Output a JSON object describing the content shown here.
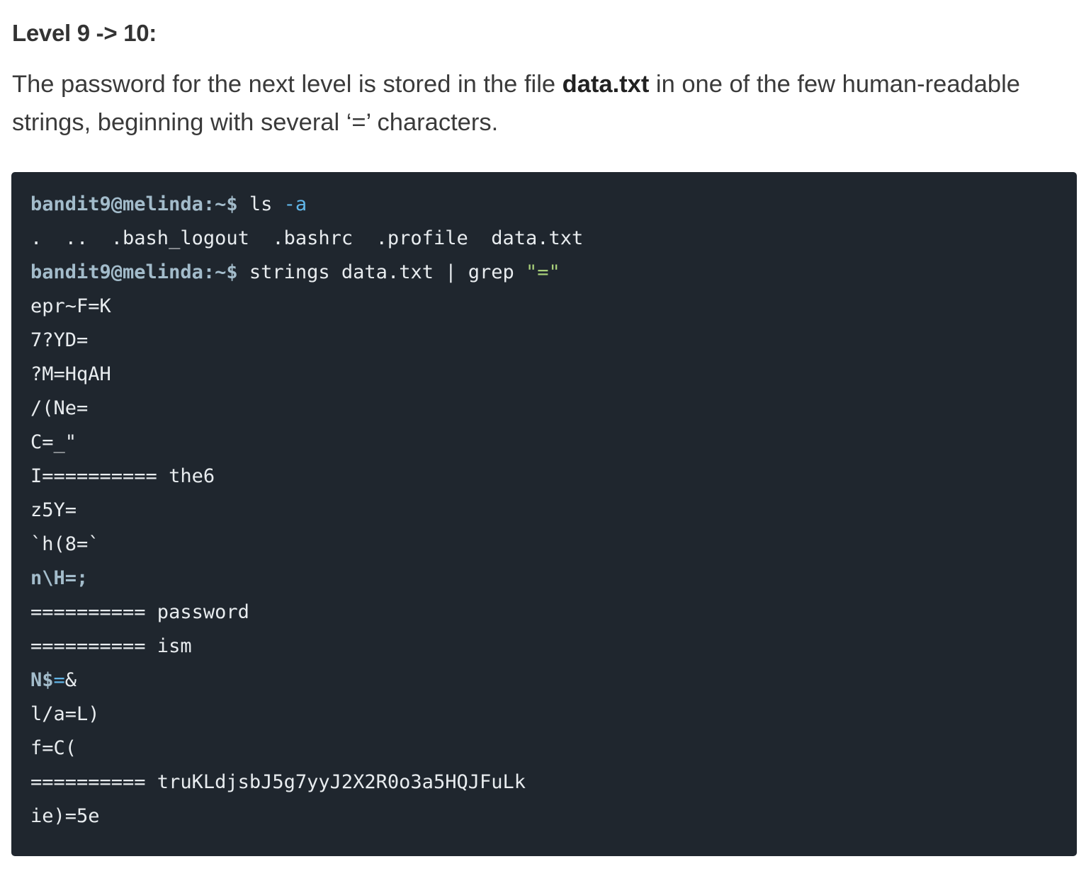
{
  "heading": "Level 9 -> 10:",
  "description": {
    "before": "The password for the next level is stored in the file ",
    "filename": "data.txt",
    "after": " in one of the few human-readable strings, beginning with several ‘=’ characters."
  },
  "terminal": {
    "prompt": "bandit9@melinda:~$",
    "command1": {
      "name": "ls",
      "flag": "-a"
    },
    "ls_output": ".  ..  .bash_logout  .bashrc  .profile  data.txt",
    "command2": {
      "text": "strings data.txt | grep",
      "arg": "\"=\""
    },
    "output_lines": {
      "l1": "epr~F=K",
      "l2": "7?YD=",
      "l3": "?M=HqAH",
      "l4": "/(Ne=",
      "l5": "C=_\"",
      "l6": "I========== the6",
      "l7": "z5Y=",
      "l8": "`h(8=`",
      "l9": "n\\H=;",
      "l10": "========== password",
      "l11": "========== ism",
      "l12a": "N$",
      "l12b": "=",
      "l12c": "&",
      "l13": "l/a=L)",
      "l14": "f=C(",
      "l15": "========== truKLdjsbJ5g7yyJ2X2R0o3a5HQJFuLk",
      "l16": "ie)=5e"
    }
  },
  "colors": {
    "terminal_background": "#1f262e",
    "prompt": "#a3bccb",
    "flag": "#61b6e8",
    "string": "#a9d07a",
    "text": "#e8ecef"
  }
}
